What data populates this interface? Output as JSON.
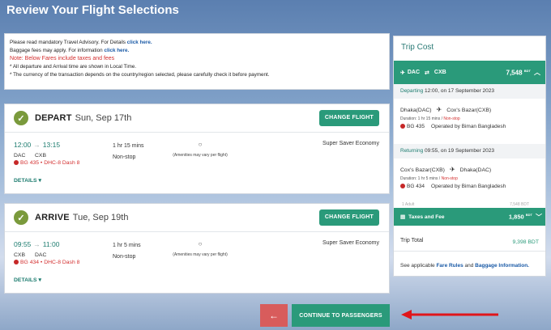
{
  "page_title": "Review Your Flight Selections",
  "notice": {
    "line1_text": "Please read mandatory Travel Advisory. For Details ",
    "line1_link": "click here.",
    "line2_text": "Baggage fees may apply. For information ",
    "line2_link": "click here.",
    "note": "Note: Below Fares include taxes and fees",
    "bullet1": "* All departure and Arrival time are shown in Local Time.",
    "bullet2": "* The currency of the transaction depends on the country/region selected, please carefully check it before payment."
  },
  "depart": {
    "direction": "DEPART",
    "date": "Sun, Sep 17th",
    "change_label": "CHANGE FLIGHT",
    "dep_time": "12:00",
    "arr_time": "13:15",
    "from": "DAC",
    "to": "CXB",
    "airline": "BG 435 • DHC-8 Dash 8",
    "duration": "1 hr 15 mins",
    "stops": "Non-stop",
    "amenities": "(Amenities may vary per flight)",
    "fare_class": "Super Saver Economy",
    "details_label": "DETAILS ▾"
  },
  "arrive": {
    "direction": "ARRIVE",
    "date": "Tue, Sep 19th",
    "change_label": "CHANGE FLIGHT",
    "dep_time": "09:55",
    "arr_time": "11:00",
    "from": "CXB",
    "to": "DAC",
    "airline": "BG 434 • DHC-8 Dash 8",
    "duration": "1 hr 5 mins",
    "stops": "Non-stop",
    "amenities": "(Amenities may vary per flight)",
    "fare_class": "Super Saver Economy",
    "details_label": "DETAILS ▾"
  },
  "trip_cost": {
    "title": "Trip Cost",
    "route_from": "DAC",
    "route_to": "CXB",
    "route_amount": "7,548",
    "currency": "BDT",
    "departing_label": "Departing",
    "departing_info": "12:00, on 17 September 2023",
    "dep_seg_from": "Dhaka(DAC)",
    "dep_seg_to": "Cox's Bazar(CXB)",
    "dep_seg_duration": "Duration: 1 hr 15 mins / ",
    "dep_seg_stops": "Non-stop",
    "dep_seg_flight": "BG 435",
    "dep_seg_operator": "Operated by Biman Bangladesh",
    "returning_label": "Returning",
    "returning_info": "09:55, on 19 September 2023",
    "ret_seg_from": "Cox's Bazar(CXB)",
    "ret_seg_to": "Dhaka(DAC)",
    "ret_seg_duration": "Duration: 1 hr 5 mins / ",
    "ret_seg_stops": "Non-stop",
    "ret_seg_flight": "BG 434",
    "ret_seg_operator": "Operated by Biman Bangladesh",
    "ghost_left": "1 Adult",
    "ghost_right": "7,548 BDT",
    "tax_label": "Taxes and Fee",
    "tax_amount": "1,850",
    "total_label": "Trip Total",
    "total_amount": "9,398 BDT",
    "rules_pre": "See applicable ",
    "rules_link1": "Fare Rules",
    "rules_mid": " and ",
    "rules_link2": "Baggage Information."
  },
  "actions": {
    "back_label": "←",
    "continue_label": "CONTINUE TO PASSENGERS"
  },
  "colors": {
    "accent": "#2a9a7a",
    "back": "#d85c5c",
    "alert": "#d32f2f"
  }
}
